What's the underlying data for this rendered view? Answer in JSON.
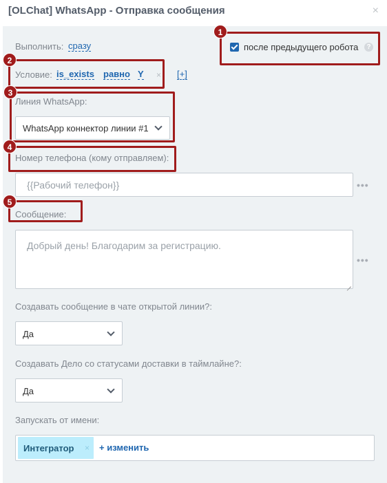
{
  "window": {
    "title": "[OLChat] WhatsApp - Отправка сообщения",
    "close_glyph": "×"
  },
  "execute": {
    "label": "Выполнить:",
    "value": "сразу"
  },
  "after_previous": {
    "label": "после предыдущего робота",
    "checked": true,
    "help_glyph": "?"
  },
  "condition": {
    "label": "Условие:",
    "field": "is_exists",
    "operator": "равно",
    "value": "Y",
    "remove_glyph": "×",
    "add_label": "[+]"
  },
  "line": {
    "label": "Линия WhatsApp:",
    "selected": "WhatsApp коннектор линии #1"
  },
  "phone": {
    "label": "Номер телефона (кому отправляем):",
    "value": "{{Рабочий телефон}}",
    "more_glyph": "•••"
  },
  "message": {
    "label": "Сообщение:",
    "value": "Добрый день! Благодарим за регистрацию.",
    "more_glyph": "•••"
  },
  "create_in_chat": {
    "label": "Создавать сообщение в чате открытой линии?:",
    "selected": "Да"
  },
  "create_deal": {
    "label": "Создавать Дело со статусами доставки в таймлайне?:",
    "selected": "Да"
  },
  "run_as": {
    "label": "Запускать от имени:",
    "user": "Интегратор",
    "remove_glyph": "×",
    "change_label": "+ изменить"
  },
  "annotations": [
    "1",
    "2",
    "3",
    "4",
    "5"
  ],
  "accent_color": "#2067b0",
  "callout_color": "#a01c1c"
}
